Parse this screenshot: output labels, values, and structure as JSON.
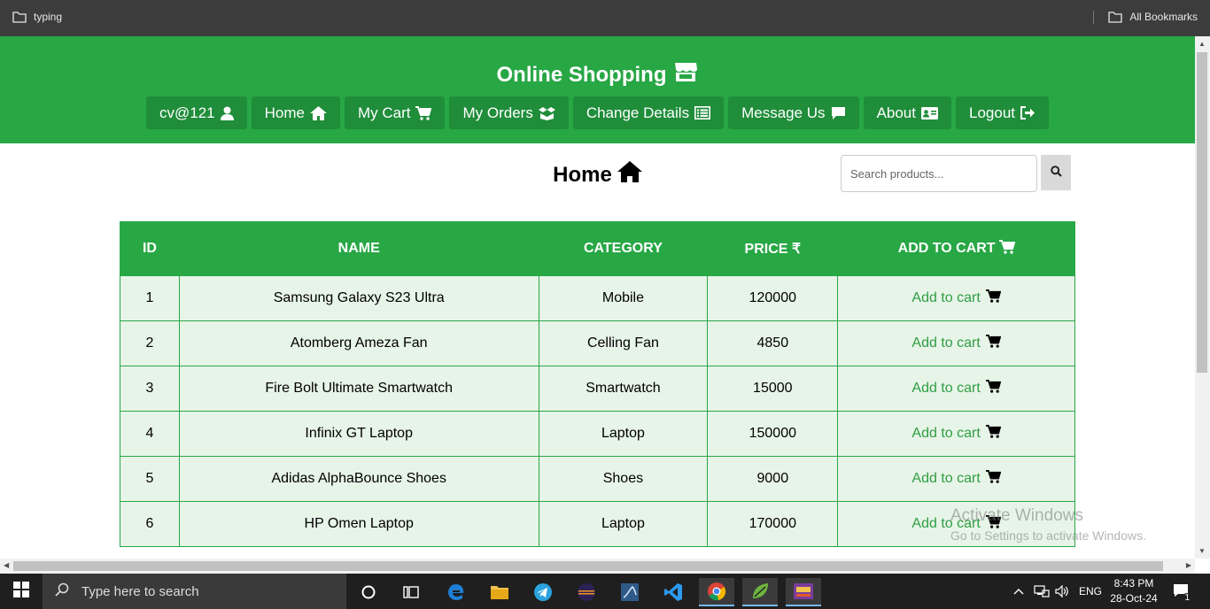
{
  "bookmarks": {
    "left_folder": "typing",
    "right_folder": "All Bookmarks"
  },
  "header": {
    "brand": "Online Shopping",
    "nav": [
      {
        "label": "cv@121",
        "icon": "user-icon"
      },
      {
        "label": "Home",
        "icon": "home-icon"
      },
      {
        "label": "My Cart",
        "icon": "cart-icon"
      },
      {
        "label": "My Orders",
        "icon": "box-open-icon"
      },
      {
        "label": "Change Details",
        "icon": "list-alt-icon"
      },
      {
        "label": "Message Us",
        "icon": "comment-icon"
      },
      {
        "label": "About",
        "icon": "id-card-icon"
      },
      {
        "label": "Logout",
        "icon": "sign-out-icon"
      }
    ]
  },
  "page": {
    "title": "Home",
    "search_placeholder": "Search products..."
  },
  "table": {
    "headers": [
      "ID",
      "NAME",
      "CATEGORY",
      "PRICE ₹",
      "ADD TO CART"
    ],
    "rows": [
      {
        "id": "1",
        "name": "Samsung Galaxy S23 Ultra",
        "category": "Mobile",
        "price": "120000",
        "action": "Add to cart"
      },
      {
        "id": "2",
        "name": "Atomberg Ameza Fan",
        "category": "Celling Fan",
        "price": "4850",
        "action": "Add to cart"
      },
      {
        "id": "3",
        "name": "Fire Bolt Ultimate Smartwatch",
        "category": "Smartwatch",
        "price": "15000",
        "action": "Add to cart"
      },
      {
        "id": "4",
        "name": "Infinix GT Laptop",
        "category": "Laptop",
        "price": "150000",
        "action": "Add to cart"
      },
      {
        "id": "5",
        "name": "Adidas AlphaBounce Shoes",
        "category": "Shoes",
        "price": "9000",
        "action": "Add to cart"
      },
      {
        "id": "6",
        "name": "HP Omen Laptop",
        "category": "Laptop",
        "price": "170000",
        "action": "Add to cart"
      }
    ]
  },
  "watermark": {
    "line1": "Activate Windows",
    "line2": "Go to Settings to activate Windows."
  },
  "taskbar": {
    "search_placeholder": "Type here to search",
    "language": "ENG",
    "time": "8:43 PM",
    "date": "28-Oct-24",
    "notification_count": "1"
  },
  "colors": {
    "brand_green": "#28a745",
    "nav_button": "#1f8d3a",
    "row_bg": "#e7f4e8",
    "link_green": "#2f9e44"
  }
}
